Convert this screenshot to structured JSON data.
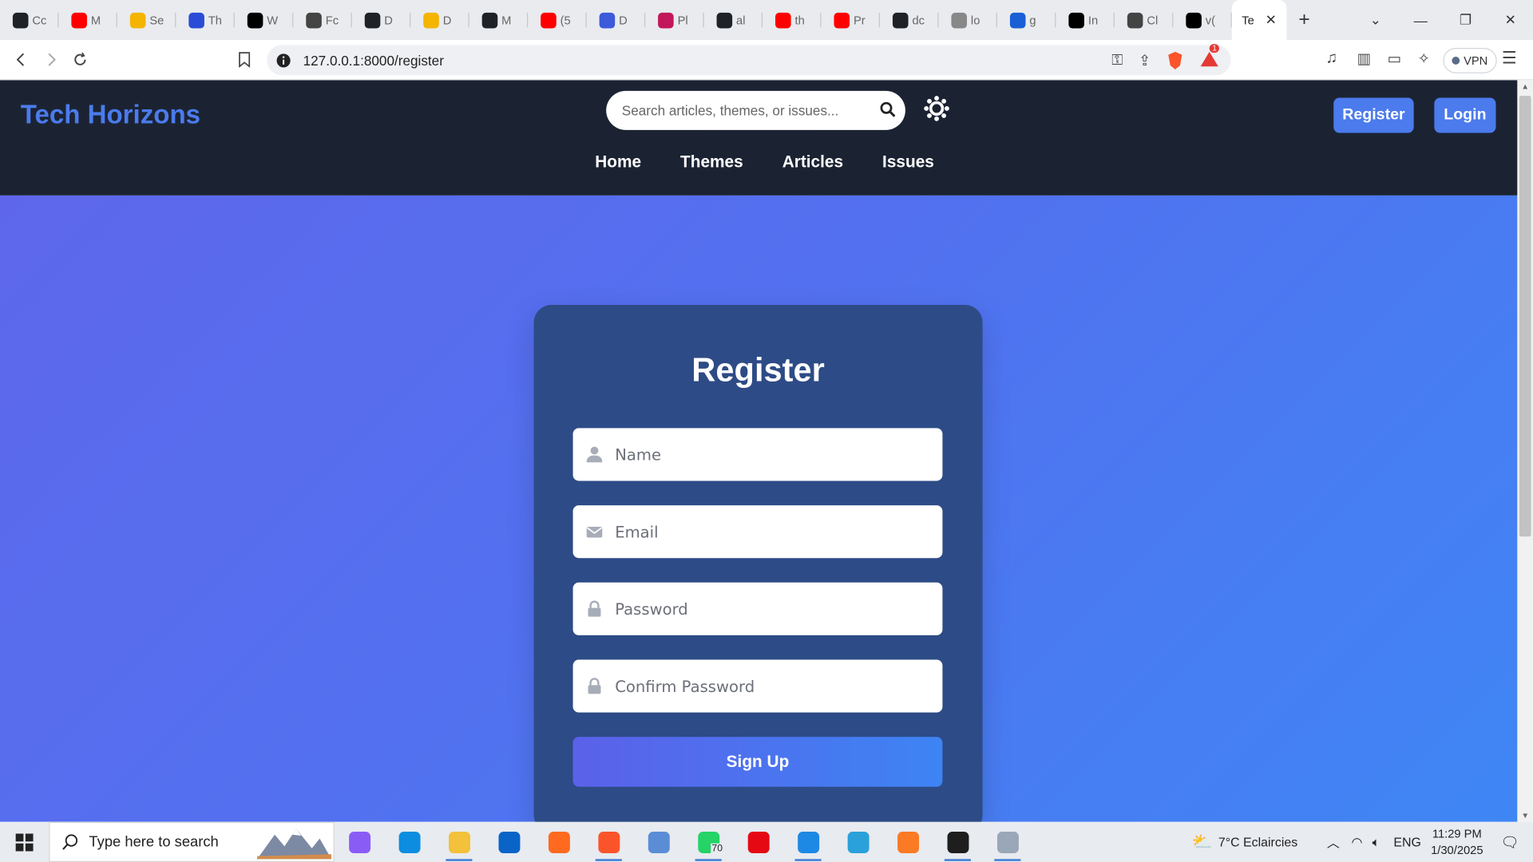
{
  "browser": {
    "tabs": [
      {
        "label": "Cc",
        "icon": "github-icon",
        "color": "#1f2328"
      },
      {
        "label": "M",
        "icon": "youtube-icon",
        "color": "#ff0000"
      },
      {
        "label": "Se",
        "icon": "search-engine-icon",
        "color": "#f4b400"
      },
      {
        "label": "Th",
        "icon": "power-icon",
        "color": "#2a4bd7"
      },
      {
        "label": "W",
        "icon": "medium-icon",
        "color": "#000000"
      },
      {
        "label": "Fc",
        "icon": "chatgpt-icon",
        "color": "#444444"
      },
      {
        "label": "D",
        "icon": "github-icon",
        "color": "#1f2328"
      },
      {
        "label": "D",
        "icon": "slides-icon",
        "color": "#f4b400"
      },
      {
        "label": "M",
        "icon": "github-icon",
        "color": "#1f2328"
      },
      {
        "label": "(5",
        "icon": "youtube-icon",
        "color": "#ff0000"
      },
      {
        "label": "D",
        "icon": "bird-icon",
        "color": "#3b5bdb"
      },
      {
        "label": "Pl",
        "icon": "multicolor-icon",
        "color": "#c2185b"
      },
      {
        "label": "al",
        "icon": "github-icon",
        "color": "#1f2328"
      },
      {
        "label": "th",
        "icon": "youtube-icon",
        "color": "#ff0000"
      },
      {
        "label": "Pr",
        "icon": "youtube-icon",
        "color": "#ff0000"
      },
      {
        "label": "dc",
        "icon": "github-icon",
        "color": "#1f2328"
      },
      {
        "label": "lo",
        "icon": "mountain-icon",
        "color": "#888888"
      },
      {
        "label": "g",
        "icon": "word-icon",
        "color": "#1a5fd6"
      },
      {
        "label": "In",
        "icon": "chatgpt-icon",
        "color": "#000000"
      },
      {
        "label": "Cl",
        "icon": "chatgpt-icon",
        "color": "#444444"
      },
      {
        "label": "v(",
        "icon": "vercel-icon",
        "color": "#000000"
      }
    ],
    "active_tab": {
      "label": "Te"
    },
    "url": "127.0.0.1:8000/register",
    "vpn_label": "VPN",
    "notification_count": "1"
  },
  "site": {
    "logo": "Tech Horizons",
    "search_placeholder": "Search articles, themes, or issues...",
    "register_label": "Register",
    "login_label": "Login",
    "nav": [
      "Home",
      "Themes",
      "Articles",
      "Issues"
    ]
  },
  "form": {
    "title": "Register",
    "fields": [
      {
        "placeholder": "Name",
        "icon": "user-icon"
      },
      {
        "placeholder": "Email",
        "icon": "envelope-icon"
      },
      {
        "placeholder": "Password",
        "icon": "lock-icon"
      },
      {
        "placeholder": "Confirm Password",
        "icon": "lock-icon"
      }
    ],
    "submit_label": "Sign Up"
  },
  "taskbar": {
    "search_placeholder": "Type here to search",
    "apps": [
      {
        "name": "copilot",
        "color": "#8a5cf6",
        "running": false
      },
      {
        "name": "edge",
        "color": "#0c8de0",
        "running": false
      },
      {
        "name": "file-explorer",
        "color": "#f3c13a",
        "running": true
      },
      {
        "name": "outlook",
        "color": "#0a64c8",
        "running": false
      },
      {
        "name": "firefox",
        "color": "#ff6a1f",
        "running": false
      },
      {
        "name": "brave",
        "color": "#fb542b",
        "running": true
      },
      {
        "name": "qbittorrent",
        "color": "#5a8dd6",
        "running": false
      },
      {
        "name": "whatsapp",
        "color": "#25d366",
        "running": true
      },
      {
        "name": "netflix",
        "color": "#e50914",
        "running": false
      },
      {
        "name": "vscode",
        "color": "#1e88e5",
        "running": true
      },
      {
        "name": "telegram",
        "color": "#2aa1da",
        "running": false
      },
      {
        "name": "xampp",
        "color": "#fb7a24",
        "running": false
      },
      {
        "name": "terminal",
        "color": "#1e1e1e",
        "running": true
      },
      {
        "name": "photos",
        "color": "#9aa7b8",
        "running": true
      }
    ],
    "whatsapp_badge": "70",
    "weather": "7°C  Eclaircies",
    "language": "ENG",
    "time": "11:29 PM",
    "date": "1/30/2025"
  }
}
